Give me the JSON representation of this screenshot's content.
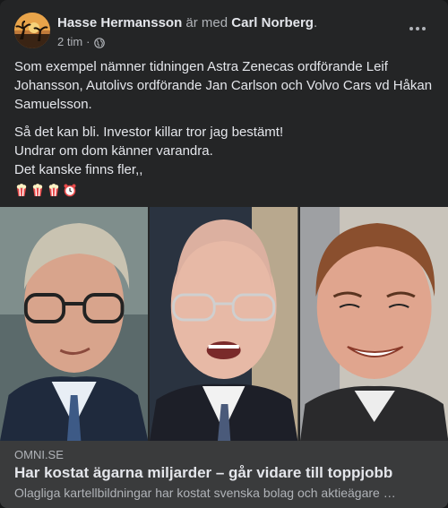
{
  "post": {
    "author": "Hasse Hermansson",
    "with_text": "är med",
    "tagged": "Carl Norberg",
    "tagged_suffix": ".",
    "time": "2 tim",
    "time_sep": "·",
    "paragraph1": "Som exempel nämner tidningen Astra Zenecas ordförande Leif Johansson, Autolivs ordförande Jan Carlson och Volvo Cars vd Håkan Samuelsson.",
    "line1": "Så det kan bli. Investor killar tror jag bestämt!",
    "line2": "Undrar om dom känner varandra.",
    "line3": "Det kanske finns fler,,",
    "emojis": [
      "popcorn-icon",
      "popcorn-icon",
      "popcorn-icon",
      "alarm-clock-icon"
    ]
  },
  "link": {
    "domain": "OMNI.SE",
    "title": "Har kostat ägarna miljarder – går vidare till toppjobb",
    "description": "Olagliga kartellbildningar har kostat svenska bolag och aktieägare …"
  },
  "colors": {
    "card_bg": "#242526",
    "link_bg": "#3a3b3c",
    "text_primary": "#e4e6eb",
    "text_secondary": "#b0b3b8"
  }
}
